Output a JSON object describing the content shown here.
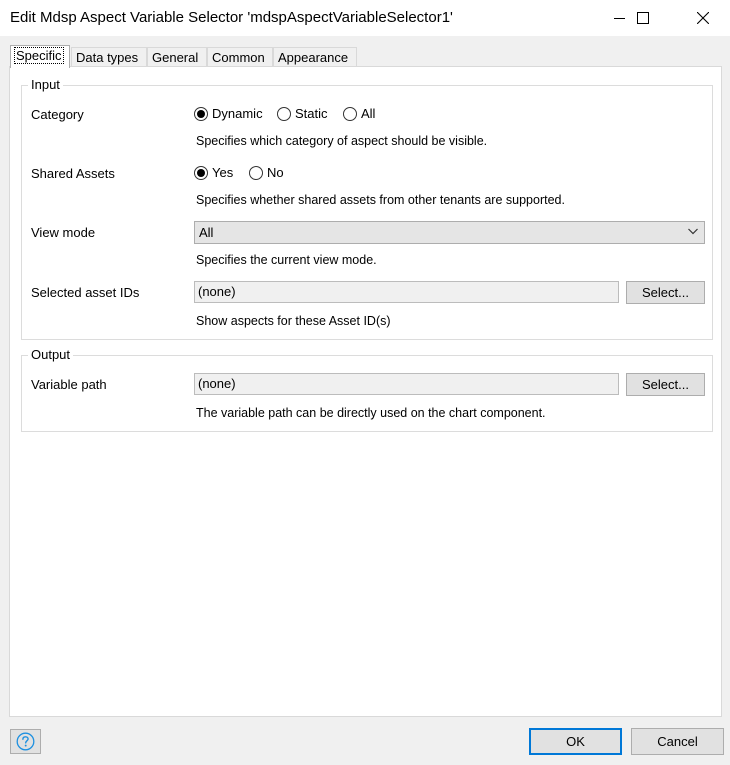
{
  "window": {
    "title": "Edit Mdsp Aspect Variable Selector 'mdspAspectVariableSelector1'"
  },
  "tabs": [
    {
      "label": "Specific",
      "active": true
    },
    {
      "label": "Data types"
    },
    {
      "label": "General"
    },
    {
      "label": "Common"
    },
    {
      "label": "Appearance"
    }
  ],
  "input_group": {
    "title": "Input",
    "category": {
      "label": "Category",
      "options": [
        "Dynamic",
        "Static",
        "All"
      ],
      "selected": "Dynamic",
      "description": "Specifies which category of aspect should be visible."
    },
    "shared_assets": {
      "label": "Shared Assets",
      "options": [
        "Yes",
        "No"
      ],
      "selected": "Yes",
      "description": "Specifies whether shared assets from other tenants are supported."
    },
    "view_mode": {
      "label": "View mode",
      "value": "All",
      "description": "Specifies the current view mode."
    },
    "selected_asset_ids": {
      "label": "Selected asset IDs",
      "value": "(none)",
      "button": "Select...",
      "description": "Show aspects for these Asset ID(s)"
    }
  },
  "output_group": {
    "title": "Output",
    "variable_path": {
      "label": "Variable path",
      "value": "(none)",
      "button": "Select...",
      "description": "The variable path can be directly used on the chart component."
    }
  },
  "footer": {
    "ok": "OK",
    "cancel": "Cancel"
  },
  "colors": {
    "accent": "#0078d7",
    "help_icon": "#1e90e0"
  }
}
